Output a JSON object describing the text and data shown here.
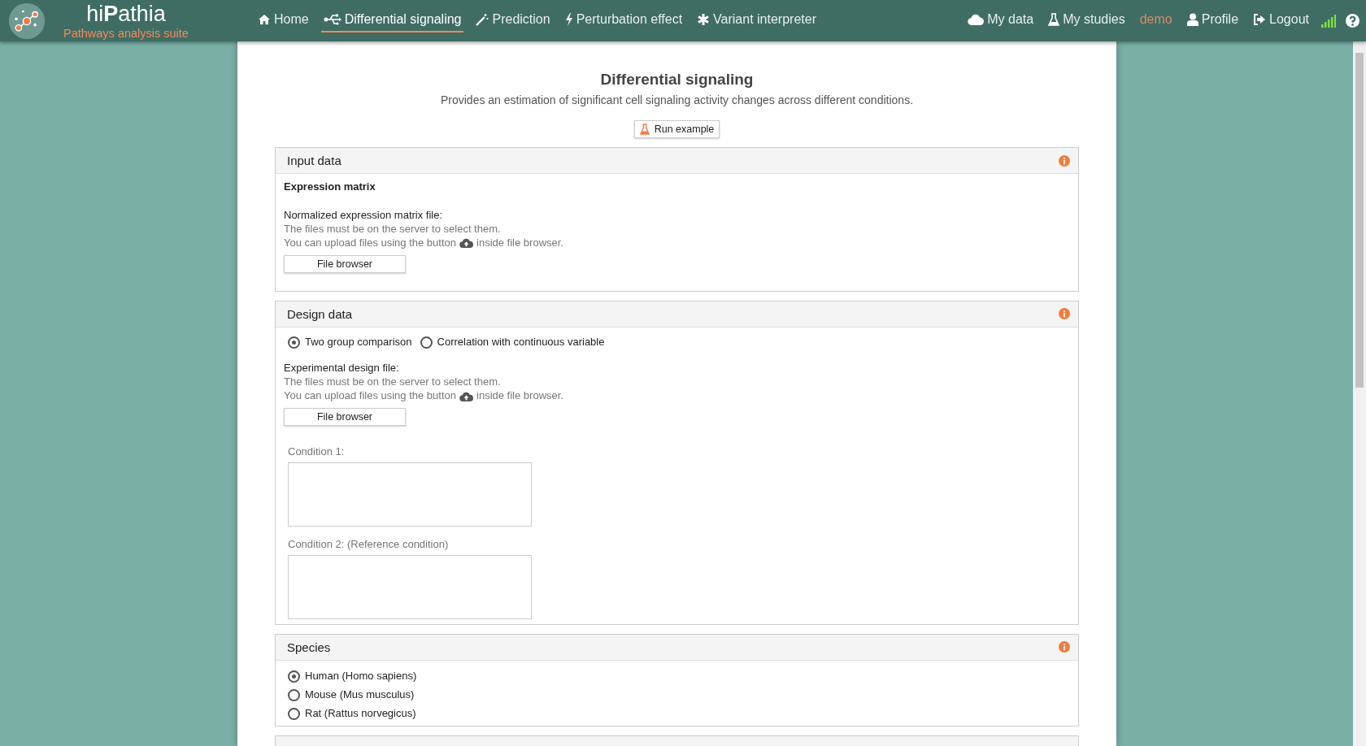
{
  "brand": {
    "title": "hi**P**athia",
    "tagline": "Pathways analysis suite"
  },
  "nav": [
    {
      "label": "Home",
      "kind": "home",
      "selected": false
    },
    {
      "label": "Differential signaling",
      "kind": "usb",
      "selected": true
    },
    {
      "label": "Prediction",
      "kind": "wand",
      "selected": false
    },
    {
      "label": "Perturbation effect",
      "kind": "bolt",
      "selected": false
    },
    {
      "label": "Variant interpreter",
      "kind": "asterisk",
      "selected": false
    }
  ],
  "user_nav": [
    {
      "label": "My data",
      "kind": "cloud"
    },
    {
      "label": "My studies",
      "kind": "flask"
    },
    {
      "label": "demo",
      "kind": "user_name"
    },
    {
      "label": "Profile",
      "kind": "user"
    },
    {
      "label": "Logout",
      "kind": "logout"
    }
  ],
  "page": {
    "title": "Differential signaling",
    "subtitle": "Provides an estimation of significant cell signaling activity changes across different conditions.",
    "run_button": "Run example"
  },
  "panels": [
    {
      "kind": "file",
      "title": "Input data",
      "section": "Expression matrix",
      "file_label": "Normalized expression matrix file:",
      "hint_1": "The files must be on the server to select them.",
      "hint_2_before": "You can upload files using the button",
      "hint_2_after": "inside file browser.",
      "button": "File browser"
    },
    {
      "kind": "design",
      "title": "Design data",
      "options": [
        {
          "label": "Two group comparison",
          "selected": true
        },
        {
          "label": "Correlation with continuous variable",
          "selected": false
        }
      ],
      "file_label": "Experimental design file:",
      "hint_1": "The files must be on the server to select them.",
      "hint_2_before": "You can upload files using the button",
      "hint_2_after": "inside file browser.",
      "button": "File browser",
      "conditions": [
        {
          "label": "Condition 1:"
        },
        {
          "label": "Condition 2: (Reference condition)"
        }
      ]
    },
    {
      "kind": "choice",
      "title": "Species",
      "options": [
        {
          "label": "Human (Homo sapiens)",
          "selected": true
        },
        {
          "label": "Mouse (Mus musculus)",
          "selected": false
        },
        {
          "label": "Rat (Rattus norvegicus)",
          "selected": false
        }
      ]
    }
  ]
}
